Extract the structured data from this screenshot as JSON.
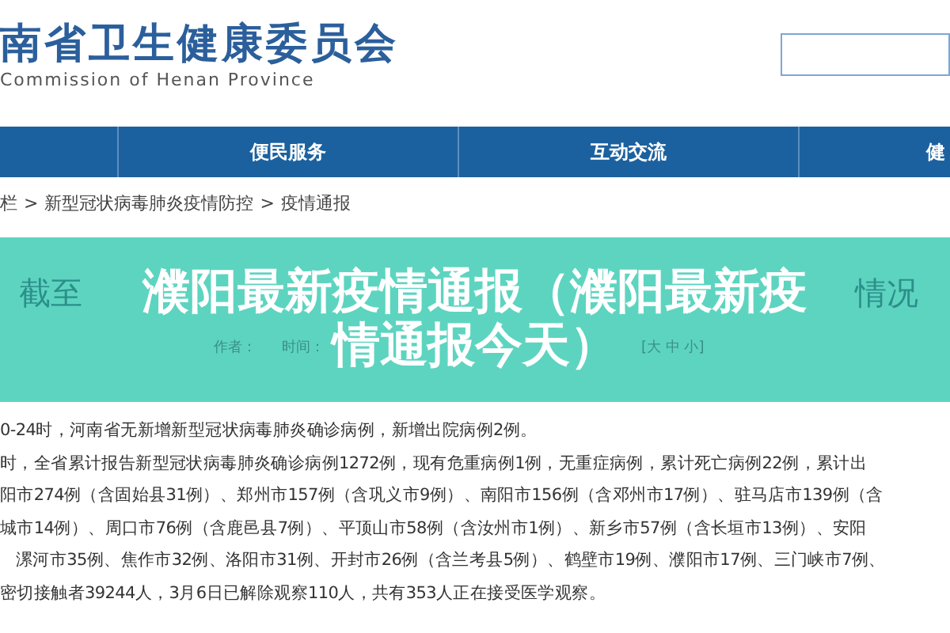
{
  "header": {
    "title": "南省卫生健康委员会",
    "subtitle": "Commission of Henan Province"
  },
  "nav": {
    "items": [
      {
        "label": "便民服务"
      },
      {
        "label": "互动交流"
      },
      {
        "label": "健"
      }
    ]
  },
  "breadcrumb": [
    "栏",
    "新型冠状病毒肺炎疫情防控",
    "疫情通报"
  ],
  "breadcrumb_separator": ">",
  "article_header": {
    "title_left": "截至",
    "title_right": "情况",
    "author_label": "作者：",
    "time_label": "时间：",
    "font_sizes": "[大 中 小]"
  },
  "banner": {
    "lines": [
      "濮阳最新疫情通报（濮阳最新疫",
      "情通报今天）"
    ]
  },
  "body": [
    {
      "text": "0-24时，河南省无新增新型冠状病毒肺炎确诊病例，新增出院病例2例。",
      "indent": false
    },
    {
      "text": "时，全省累计报告新型冠状病毒肺炎确诊病例1272例，现有危重病例1例，无重症病例，累计死亡病例22例，累计出",
      "indent": false
    },
    {
      "text": "阳市274例（含固始县31例）、郑州市157例（含巩义市9例）、南阳市156例（含邓州市17例）、驻马店市139例（含",
      "indent": false
    },
    {
      "text": "城市14例）、周口市76例（含鹿邑县7例）、平顶山市58例（含汝州市1例）、新乡市57例（含长垣市13例）、安阳",
      "indent": false
    },
    {
      "text": "漯河市35例、焦作市32例、洛阳市31例、开封市26例（含兰考县5例）、鹤壁市19例、濮阳市17例、三门峡市7例、",
      "indent": true
    },
    {
      "text": "密切接触者39244人，3月6日已解除观察110人，共有353人正在接受医学观察。",
      "indent": false
    }
  ]
}
